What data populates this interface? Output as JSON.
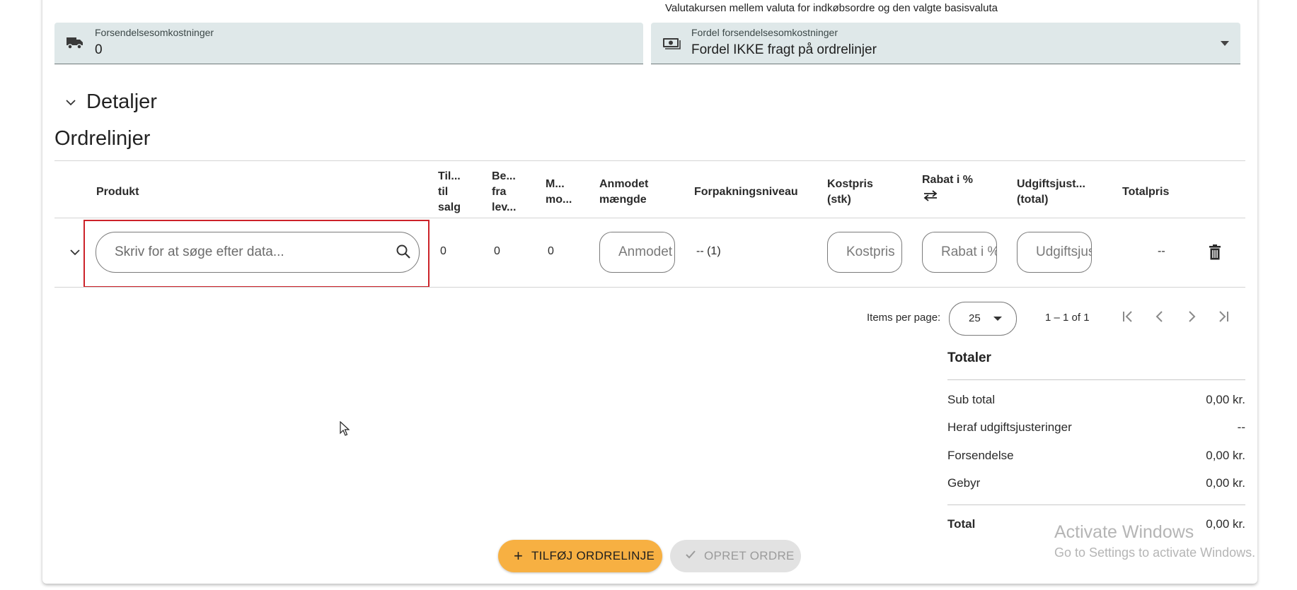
{
  "rate_note": "Valutakursen mellem valuta for indkøbsordre og den valgte basisvaluta",
  "shipping_field": {
    "label": "Forsendelsesomkostninger",
    "value": "0",
    "icon": "truck-icon"
  },
  "distribution_field": {
    "label": "Fordel forsendelsesomkostninger",
    "value": "Fordel IKKE fragt på ordrelinjer",
    "icon": "cash-icon"
  },
  "sections": {
    "details": "Detaljer",
    "order_lines": "Ordrelinjer"
  },
  "table": {
    "headers": {
      "product": "Produkt",
      "available": [
        "Til...",
        "til",
        "salg"
      ],
      "ordered": [
        "Be...",
        "fra",
        "lev..."
      ],
      "received": [
        "M...",
        "mo..."
      ],
      "requested": [
        "Anmodet",
        "mængde"
      ],
      "packaging": "Forpakningsniveau",
      "cost": [
        "Kostpris",
        "(stk)"
      ],
      "discount": "Rabat i %",
      "expense": [
        "Udgiftsjust...",
        "(total)"
      ],
      "total": "Totalpris"
    },
    "row": {
      "search_placeholder": "Skriv for at søge efter data...",
      "available": "0",
      "ordered": "0",
      "received": "0",
      "requested_placeholder": "Anmodet mængde",
      "packaging": "-- (1)",
      "cost_placeholder": "Kostpris",
      "discount_placeholder": "Rabat i %",
      "expense_placeholder": "Udgiftsjustering",
      "total": "--"
    }
  },
  "pagination": {
    "label": "Items per page:",
    "page_size": "25",
    "range": "1 – 1 of 1"
  },
  "totals": {
    "title": "Totaler",
    "rows": [
      {
        "label": "Sub total",
        "value": "0,00 kr."
      },
      {
        "label": "Heraf udgiftsjusteringer",
        "value": "--"
      },
      {
        "label": "Forsendelse",
        "value": "0,00 kr."
      },
      {
        "label": "Gebyr",
        "value": "0,00 kr."
      }
    ],
    "total": {
      "label": "Total",
      "value": "0,00 kr."
    }
  },
  "actions": {
    "add_line": "TILFØJ ORDRELINJE",
    "create_order": "OPRET ORDRE"
  },
  "watermark": {
    "line1": "Activate Windows",
    "line2": "Go to Settings to activate Windows."
  },
  "colors": {
    "accent": "#f7b042",
    "field_bg": "#dfe8e9",
    "highlight": "#cc2229"
  }
}
